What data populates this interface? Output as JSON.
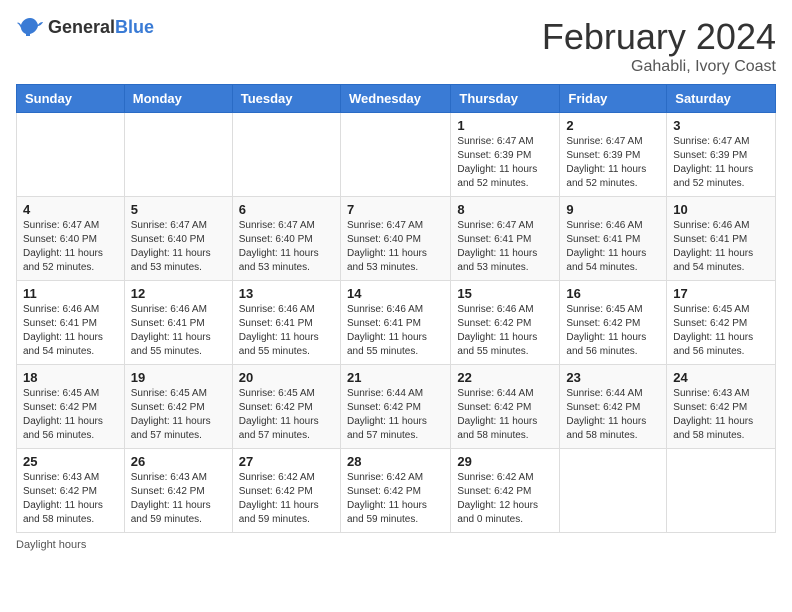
{
  "header": {
    "logo": {
      "general": "General",
      "blue": "Blue"
    },
    "title": "February 2024",
    "subtitle": "Gahabli, Ivory Coast"
  },
  "columns": [
    "Sunday",
    "Monday",
    "Tuesday",
    "Wednesday",
    "Thursday",
    "Friday",
    "Saturday"
  ],
  "weeks": [
    [
      {
        "day": "",
        "info": ""
      },
      {
        "day": "",
        "info": ""
      },
      {
        "day": "",
        "info": ""
      },
      {
        "day": "",
        "info": ""
      },
      {
        "day": "1",
        "info": "Sunrise: 6:47 AM\nSunset: 6:39 PM\nDaylight: 11 hours and 52 minutes."
      },
      {
        "day": "2",
        "info": "Sunrise: 6:47 AM\nSunset: 6:39 PM\nDaylight: 11 hours and 52 minutes."
      },
      {
        "day": "3",
        "info": "Sunrise: 6:47 AM\nSunset: 6:39 PM\nDaylight: 11 hours and 52 minutes."
      }
    ],
    [
      {
        "day": "4",
        "info": "Sunrise: 6:47 AM\nSunset: 6:40 PM\nDaylight: 11 hours and 52 minutes."
      },
      {
        "day": "5",
        "info": "Sunrise: 6:47 AM\nSunset: 6:40 PM\nDaylight: 11 hours and 53 minutes."
      },
      {
        "day": "6",
        "info": "Sunrise: 6:47 AM\nSunset: 6:40 PM\nDaylight: 11 hours and 53 minutes."
      },
      {
        "day": "7",
        "info": "Sunrise: 6:47 AM\nSunset: 6:40 PM\nDaylight: 11 hours and 53 minutes."
      },
      {
        "day": "8",
        "info": "Sunrise: 6:47 AM\nSunset: 6:41 PM\nDaylight: 11 hours and 53 minutes."
      },
      {
        "day": "9",
        "info": "Sunrise: 6:46 AM\nSunset: 6:41 PM\nDaylight: 11 hours and 54 minutes."
      },
      {
        "day": "10",
        "info": "Sunrise: 6:46 AM\nSunset: 6:41 PM\nDaylight: 11 hours and 54 minutes."
      }
    ],
    [
      {
        "day": "11",
        "info": "Sunrise: 6:46 AM\nSunset: 6:41 PM\nDaylight: 11 hours and 54 minutes."
      },
      {
        "day": "12",
        "info": "Sunrise: 6:46 AM\nSunset: 6:41 PM\nDaylight: 11 hours and 55 minutes."
      },
      {
        "day": "13",
        "info": "Sunrise: 6:46 AM\nSunset: 6:41 PM\nDaylight: 11 hours and 55 minutes."
      },
      {
        "day": "14",
        "info": "Sunrise: 6:46 AM\nSunset: 6:41 PM\nDaylight: 11 hours and 55 minutes."
      },
      {
        "day": "15",
        "info": "Sunrise: 6:46 AM\nSunset: 6:42 PM\nDaylight: 11 hours and 55 minutes."
      },
      {
        "day": "16",
        "info": "Sunrise: 6:45 AM\nSunset: 6:42 PM\nDaylight: 11 hours and 56 minutes."
      },
      {
        "day": "17",
        "info": "Sunrise: 6:45 AM\nSunset: 6:42 PM\nDaylight: 11 hours and 56 minutes."
      }
    ],
    [
      {
        "day": "18",
        "info": "Sunrise: 6:45 AM\nSunset: 6:42 PM\nDaylight: 11 hours and 56 minutes."
      },
      {
        "day": "19",
        "info": "Sunrise: 6:45 AM\nSunset: 6:42 PM\nDaylight: 11 hours and 57 minutes."
      },
      {
        "day": "20",
        "info": "Sunrise: 6:45 AM\nSunset: 6:42 PM\nDaylight: 11 hours and 57 minutes."
      },
      {
        "day": "21",
        "info": "Sunrise: 6:44 AM\nSunset: 6:42 PM\nDaylight: 11 hours and 57 minutes."
      },
      {
        "day": "22",
        "info": "Sunrise: 6:44 AM\nSunset: 6:42 PM\nDaylight: 11 hours and 58 minutes."
      },
      {
        "day": "23",
        "info": "Sunrise: 6:44 AM\nSunset: 6:42 PM\nDaylight: 11 hours and 58 minutes."
      },
      {
        "day": "24",
        "info": "Sunrise: 6:43 AM\nSunset: 6:42 PM\nDaylight: 11 hours and 58 minutes."
      }
    ],
    [
      {
        "day": "25",
        "info": "Sunrise: 6:43 AM\nSunset: 6:42 PM\nDaylight: 11 hours and 58 minutes."
      },
      {
        "day": "26",
        "info": "Sunrise: 6:43 AM\nSunset: 6:42 PM\nDaylight: 11 hours and 59 minutes."
      },
      {
        "day": "27",
        "info": "Sunrise: 6:42 AM\nSunset: 6:42 PM\nDaylight: 11 hours and 59 minutes."
      },
      {
        "day": "28",
        "info": "Sunrise: 6:42 AM\nSunset: 6:42 PM\nDaylight: 11 hours and 59 minutes."
      },
      {
        "day": "29",
        "info": "Sunrise: 6:42 AM\nSunset: 6:42 PM\nDaylight: 12 hours and 0 minutes."
      },
      {
        "day": "",
        "info": ""
      },
      {
        "day": "",
        "info": ""
      }
    ]
  ],
  "footer": {
    "note": "Daylight hours"
  }
}
